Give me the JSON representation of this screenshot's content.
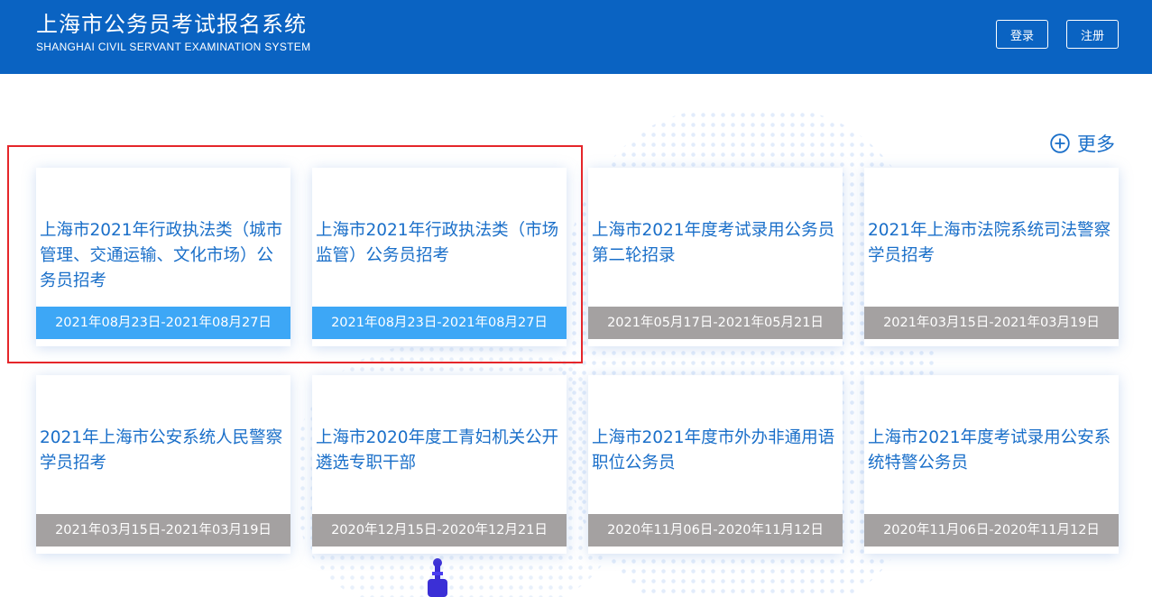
{
  "header": {
    "title": "上海市公务员考试报名系统",
    "subtitle": "SHANGHAI CIVIL SERVANT EXAMINATION SYSTEM",
    "login_label": "登录",
    "register_label": "注册",
    "bg_color": "#0a63c2"
  },
  "more": {
    "label": "更多",
    "icon": "plus-circle-icon"
  },
  "cards": [
    {
      "title": "上海市2021年行政执法类（城市管理、交通运输、文化市场）公务员招考",
      "date": "2021年08月23日-2021年08月27日",
      "status": "active"
    },
    {
      "title": "上海市2021年行政执法类（市场监管）公务员招考",
      "date": "2021年08月23日-2021年08月27日",
      "status": "active"
    },
    {
      "title": "上海市2021年度考试录用公务员第二轮招录",
      "date": "2021年05月17日-2021年05月21日",
      "status": "past"
    },
    {
      "title": "2021年上海市法院系统司法警察学员招考",
      "date": "2021年03月15日-2021年03月19日",
      "status": "past"
    },
    {
      "title": "2021年上海市公安系统人民警察学员招考",
      "date": "2021年03月15日-2021年03月19日",
      "status": "past"
    },
    {
      "title": "上海市2020年度工青妇机关公开遴选专职干部",
      "date": "2020年12月15日-2020年12月21日",
      "status": "past"
    },
    {
      "title": "上海市2021年度市外办非通用语职位公务员",
      "date": "2020年11月06日-2020年11月12日",
      "status": "past"
    },
    {
      "title": "上海市2021年度考试录用公安系统特警公务员",
      "date": "2020年11月06日-2020年11月12日",
      "status": "past"
    }
  ],
  "colors": {
    "accent": "#1a6fc9",
    "date_active": "#3da7f6",
    "date_past": "#a4a1a1",
    "highlight": "#e5262a"
  }
}
